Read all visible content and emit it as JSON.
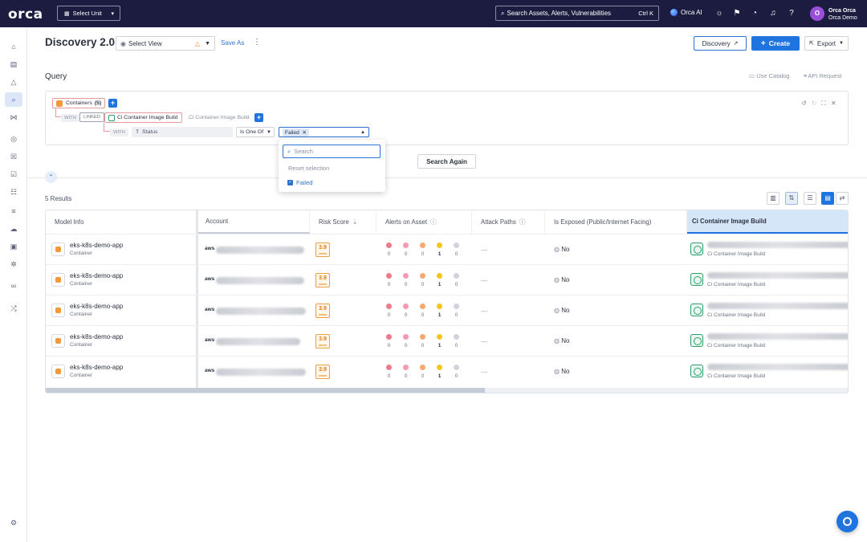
{
  "topbar": {
    "logo": "orca",
    "unit_select": "Select Unit",
    "search_placeholder": "Search Assets, Alerts, Vulnerabilities",
    "search_shortcut": "Ctrl K",
    "orca_ai": "Orca AI",
    "avatar_initial": "O",
    "user_name": "Orca Orca",
    "user_org": "Orca Demo"
  },
  "header": {
    "title": "Discovery 2.0",
    "view_select": "Select View",
    "save_as": "Save As",
    "discovery_btn": "Discovery",
    "create_btn": "Create",
    "export_btn": "Export"
  },
  "query": {
    "label": "Query",
    "use_catalog": "Use Catalog",
    "api_request": "API Request",
    "root_chip": "Containers",
    "root_count": "(5)",
    "with_label": "WITH",
    "linked_label": "LINKED",
    "linked_chip": "Ci Container Image Build",
    "linked_hint": "Ci Container Image Build",
    "filter_field": "Status",
    "operator": "Is One Of",
    "value_tag": "Failed",
    "dropdown": {
      "search_placeholder": "Search",
      "reset": "Reset selection",
      "option": "Failed"
    },
    "search_again": "Search Again"
  },
  "results": {
    "count_label": "5 Results",
    "columns": [
      "Model Info",
      "Account",
      "Risk Score",
      "Alerts on Asset",
      "Attack Paths",
      "Is Exposed (Public/Internet Facing)",
      "Ci Container Image Build"
    ],
    "alert_counts": [
      "0",
      "0",
      "0",
      "1",
      "0"
    ],
    "rows": [
      {
        "name": "eks-k8s-demo-app",
        "type": "Container",
        "account": "aws",
        "risk": "3.9",
        "attack": "---",
        "exposed": "No",
        "ci_sub": "Ci Container Image Build"
      },
      {
        "name": "eks-k8s-demo-app",
        "type": "Container",
        "account": "aws",
        "risk": "3.9",
        "attack": "---",
        "exposed": "No",
        "ci_sub": "Ci Container Image Build"
      },
      {
        "name": "eks-k8s-demo-app",
        "type": "Container",
        "account": "aws",
        "risk": "3.9",
        "attack": "---",
        "exposed": "No",
        "ci_sub": "Ci Container Image Build"
      },
      {
        "name": "eks-k8s-demo-app",
        "type": "Container",
        "account": "aws",
        "risk": "3.9",
        "attack": "---",
        "exposed": "No",
        "ci_sub": "Ci Container Image Build"
      },
      {
        "name": "eks-k8s-demo-app",
        "type": "Container",
        "account": "aws",
        "risk": "3.9",
        "attack": "---",
        "exposed": "No",
        "ci_sub": "Ci Container Image Build"
      }
    ]
  },
  "colors": {
    "topbar_bg": "#1b1c3f",
    "accent": "#1f74e0",
    "risk_orange": "#e07a10",
    "alert_critical": "#f07a8a",
    "alert_high": "#f59bb0",
    "alert_medium": "#f7a870",
    "alert_low": "#f5c518",
    "alert_info": "#cfd4dc"
  }
}
